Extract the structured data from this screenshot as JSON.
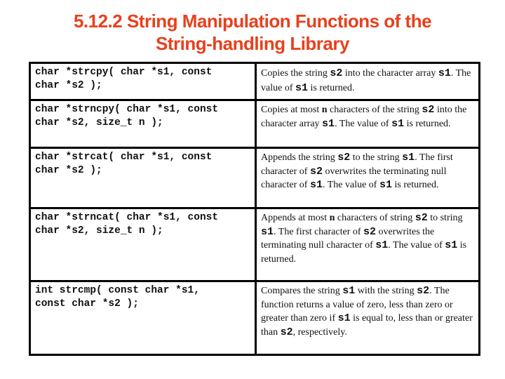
{
  "title": {
    "line1": "5.12.2 String Manipulation Functions of the",
    "line2": "String-handling Library"
  },
  "colors": {
    "title": "#e8401c",
    "border": "#000000",
    "text": "#111111"
  },
  "table": {
    "rows": [
      {
        "prototype": "char *strcpy( char *s1, const\nchar *s2 );",
        "description": [
          {
            "t": "Copies the string "
          },
          {
            "t": "s2",
            "code": true
          },
          {
            "t": " into the character array "
          },
          {
            "t": "s1",
            "code": true
          },
          {
            "t": ". The value of "
          },
          {
            "t": "s1",
            "code": true
          },
          {
            "t": " is returned."
          }
        ]
      },
      {
        "prototype": "char *strncpy( char *s1, const\nchar *s2, size_t n );",
        "description": [
          {
            "t": "Copies at most "
          },
          {
            "t": "n",
            "bold": true
          },
          {
            "t": " characters of the string "
          },
          {
            "t": "s2",
            "code": true
          },
          {
            "t": " into the character array "
          },
          {
            "t": "s1",
            "code": true
          },
          {
            "t": ". The value of "
          },
          {
            "t": "s1",
            "code": true
          },
          {
            "t": " is returned."
          }
        ]
      },
      {
        "prototype": "char *strcat( char *s1, const\nchar *s2 );",
        "description": [
          {
            "t": "Appends the string "
          },
          {
            "t": "s2",
            "code": true
          },
          {
            "t": " to the string "
          },
          {
            "t": "s1",
            "code": true
          },
          {
            "t": ". The first character of "
          },
          {
            "t": "s2",
            "code": true
          },
          {
            "t": " overwrites the terminating null character of "
          },
          {
            "t": "s1",
            "code": true
          },
          {
            "t": ". The value of "
          },
          {
            "t": "s1",
            "code": true
          },
          {
            "t": " is returned."
          }
        ]
      },
      {
        "prototype": "char *strncat( char *s1, const\nchar *s2, size_t n );",
        "description": [
          {
            "t": "Appends at most "
          },
          {
            "t": "n",
            "bold": true
          },
          {
            "t": " characters of string "
          },
          {
            "t": "s2",
            "code": true
          },
          {
            "t": " to string "
          },
          {
            "t": "s1",
            "code": true
          },
          {
            "t": ". The first character of "
          },
          {
            "t": "s2",
            "code": true
          },
          {
            "t": " overwrites the terminating null character of "
          },
          {
            "t": "s1",
            "code": true
          },
          {
            "t": ". The value of "
          },
          {
            "t": "s1",
            "code": true
          },
          {
            "t": " is returned."
          }
        ]
      },
      {
        "prototype": "int strcmp( const char *s1,\nconst char *s2 );",
        "description": [
          {
            "t": "Compares the string "
          },
          {
            "t": "s1",
            "code": true
          },
          {
            "t": " with the string "
          },
          {
            "t": "s2",
            "code": true
          },
          {
            "t": ". The function returns a value of zero, less than zero or greater than zero if "
          },
          {
            "t": "s1",
            "code": true
          },
          {
            "t": " is equal to, less than or greater than "
          },
          {
            "t": "s2",
            "code": true
          },
          {
            "t": ", respectively."
          }
        ]
      }
    ]
  }
}
